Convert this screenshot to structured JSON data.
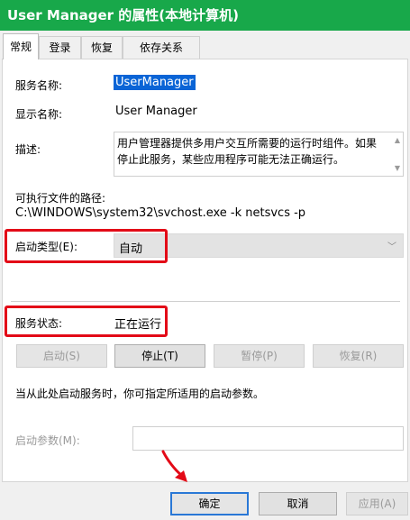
{
  "window": {
    "title": "User Manager 的属性(本地计算机)"
  },
  "tabs": [
    {
      "label": "常规",
      "active": true
    },
    {
      "label": "登录",
      "active": false
    },
    {
      "label": "恢复",
      "active": false
    },
    {
      "label": "依存关系",
      "active": false
    }
  ],
  "general": {
    "service_name_label": "服务名称:",
    "service_name_value": "UserManager",
    "display_name_label": "显示名称:",
    "display_name_value": "User Manager",
    "description_label": "描述:",
    "description_value": "用户管理器提供多用户交互所需要的运行时组件。如果停止此服务，某些应用程序可能无法正确运行。",
    "exe_path_label": "可执行文件的路径:",
    "exe_path_value": "C:\\WINDOWS\\system32\\svchost.exe -k netsvcs -p",
    "startup_type_label": "启动类型(E):",
    "startup_type_value": "自动",
    "service_status_label": "服务状态:",
    "service_status_value": "正在运行",
    "buttons": {
      "start": "启动(S)",
      "stop": "停止(T)",
      "pause": "暂停(P)",
      "resume": "恢复(R)"
    },
    "hint_text": "当从此处启动服务时，你可指定所适用的启动参数。",
    "start_params_label": "启动参数(M):",
    "start_params_value": ""
  },
  "footer": {
    "ok": "确定",
    "cancel": "取消",
    "apply": "应用(A)"
  },
  "colors": {
    "titlebar": "#18a84a",
    "highlight": "#e30a17",
    "selection": "#0a64d6"
  }
}
